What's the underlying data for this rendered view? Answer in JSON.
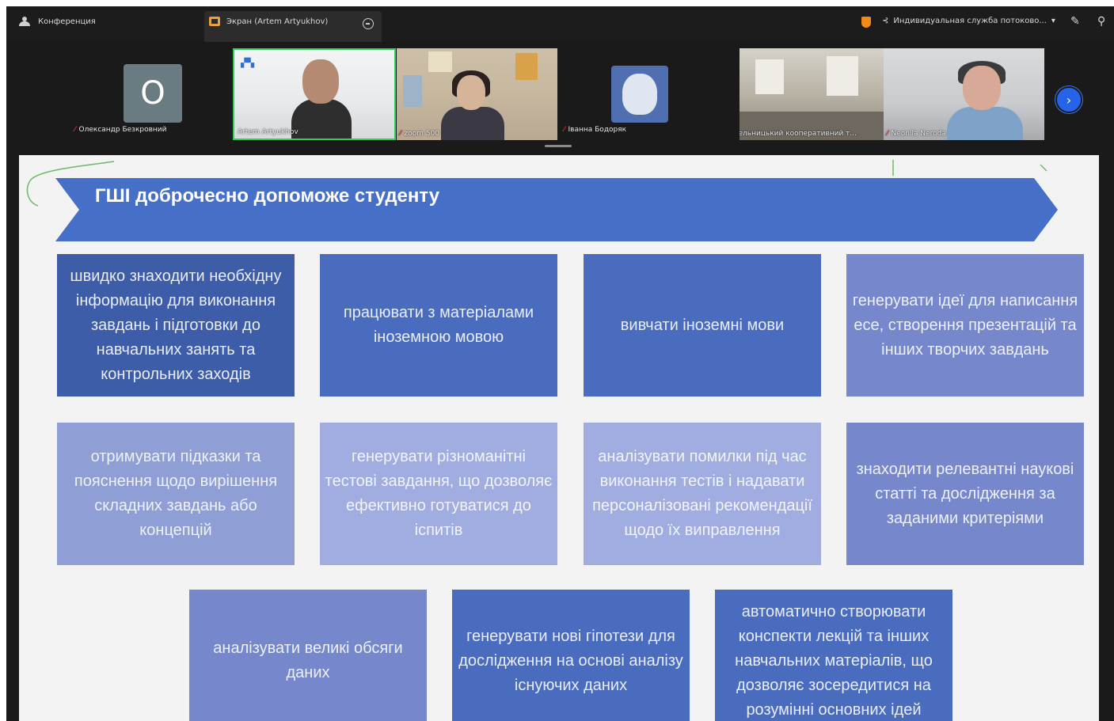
{
  "topbar": {
    "conference_label": "Конференция",
    "screen_tab_label": "Экран (Artem Artyukhov)",
    "stream_label": "Индивидуальная служба потоково..."
  },
  "participants": [
    {
      "name": "Олександр Безкровний",
      "avatar_letter": "О"
    },
    {
      "name": "Artem Artyukhov"
    },
    {
      "name": "zoom 500"
    },
    {
      "name": "Іванна Бодоряк"
    },
    {
      "name": "Хмельницький кооперативний т..."
    },
    {
      "name": "Neonila Neroda"
    }
  ],
  "slide": {
    "title": "ГШІ доброчесно допоможе студенту",
    "cards": [
      "швидко знаходити необхідну інформацію для виконання завдань і підготовки до навчальних занять та контрольних заходів",
      "працювати з матеріалами іноземною мовою",
      "вивчати іноземні мови",
      "генерувати ідеї для написання есе, створення презентацій та інших творчих завдань",
      "отримувати підказки та пояснення щодо вирішення складних завдань або концепцій",
      "генерувати різноманітні тестові завдання, що дозволяє ефективно готуватися до іспитів",
      "аналізувати помилки під час виконання тестів і надавати персоналізовані рекомендації щодо їх виправлення",
      "знаходити релевантні наукові статті та дослідження за заданими критеріями",
      "аналізувати великі обсяги даних",
      "генерувати нові гіпотези для дослідження на основі аналізу існуючих даних",
      "автоматично створювати конспекти лекцій та інших навчальних матеріалів, що дозволяє зосередитися на розумінні основних ідей"
    ]
  },
  "colors": {
    "banner": "#4670c8",
    "active_speaker_border": "#2fd15a",
    "next_button": "#2563eb"
  }
}
